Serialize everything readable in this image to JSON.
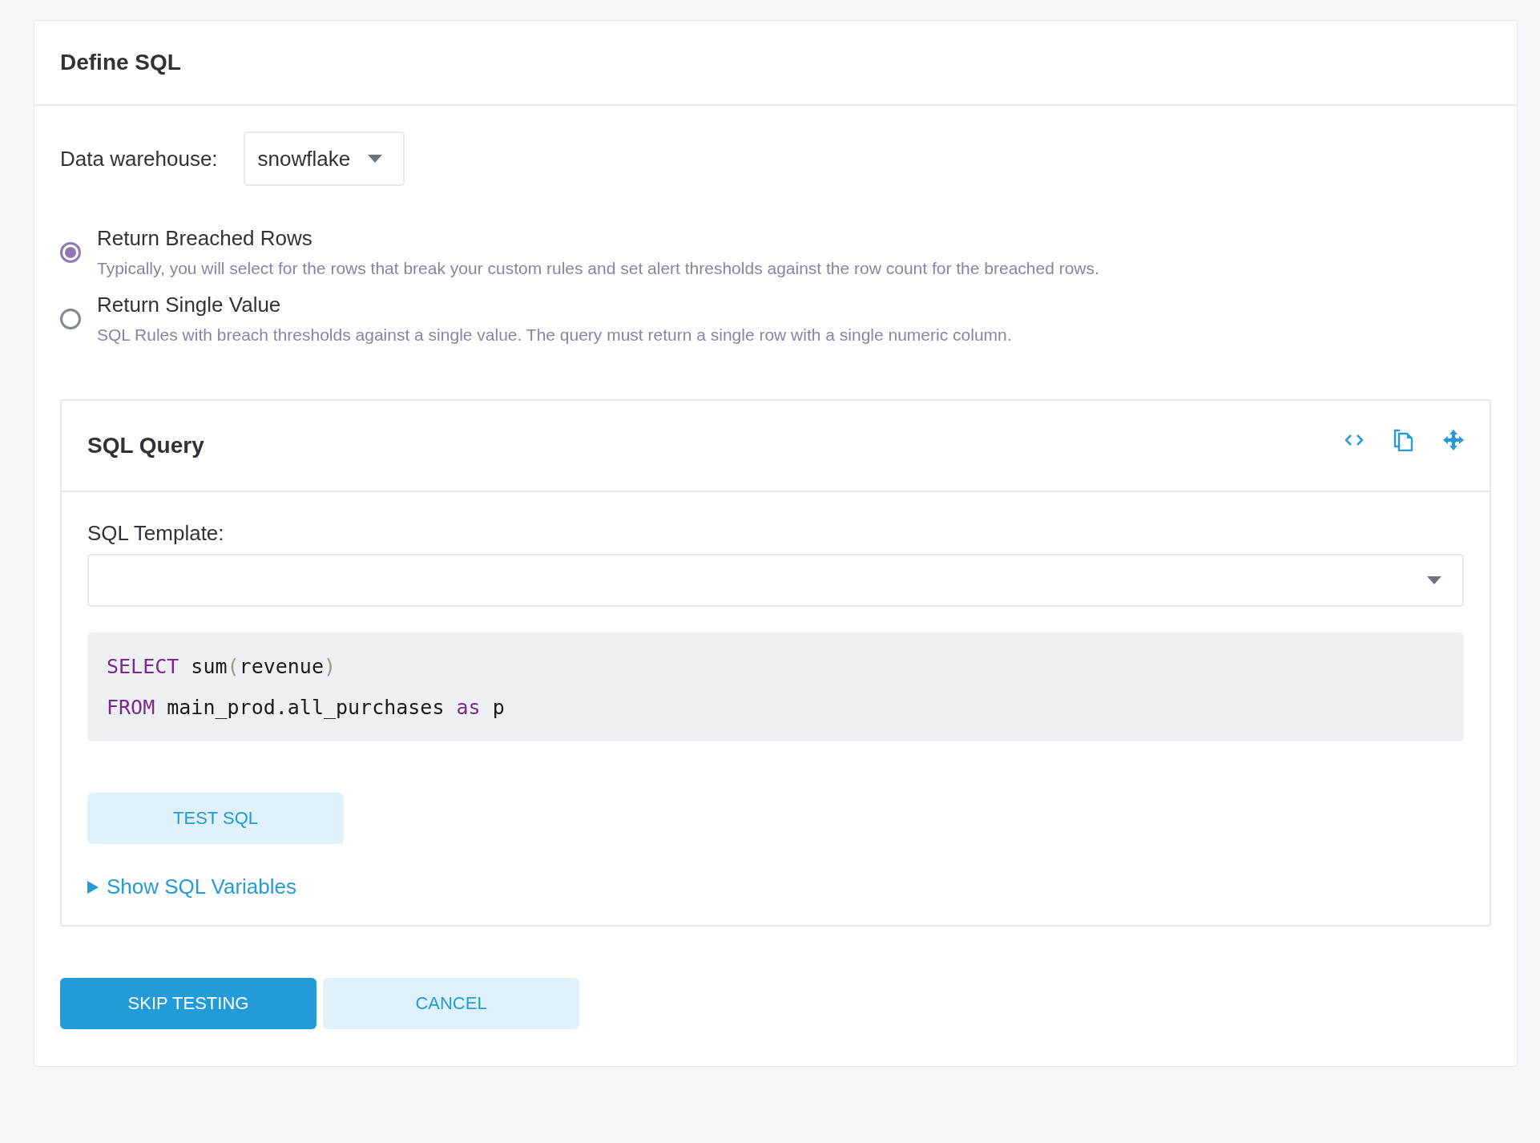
{
  "card": {
    "title": "Define SQL"
  },
  "warehouse": {
    "label": "Data warehouse:",
    "value": "snowflake"
  },
  "return_options": [
    {
      "label": "Return Breached Rows",
      "description": "Typically, you will select for the rows that break your custom rules and set alert thresholds against the row count for the breached rows.",
      "selected": true
    },
    {
      "label": "Return Single Value",
      "description": "SQL Rules with breach thresholds against a single value. The query must return a single row with a single numeric column.",
      "selected": false
    }
  ],
  "sql_panel": {
    "title": "SQL Query",
    "template_label": "SQL Template:",
    "code_lines": [
      [
        {
          "kind": "keyword",
          "text": "SELECT"
        },
        {
          "kind": "plain",
          "text": " sum"
        },
        {
          "kind": "paren",
          "text": "("
        },
        {
          "kind": "plain",
          "text": "revenue"
        },
        {
          "kind": "paren",
          "text": ")"
        }
      ],
      [
        {
          "kind": "keyword",
          "text": "FROM"
        },
        {
          "kind": "plain",
          "text": " main_prod.all_purchases "
        },
        {
          "kind": "keyword",
          "text": "as"
        },
        {
          "kind": "plain",
          "text": " p"
        }
      ]
    ],
    "test_button": "TEST SQL",
    "variables_toggle": {
      "label": "Show SQL Variables",
      "expanded": false
    }
  },
  "actions": [
    {
      "label": "SKIP TESTING",
      "kind": "primary"
    },
    {
      "label": "CANCEL",
      "kind": "secondary"
    }
  ]
}
